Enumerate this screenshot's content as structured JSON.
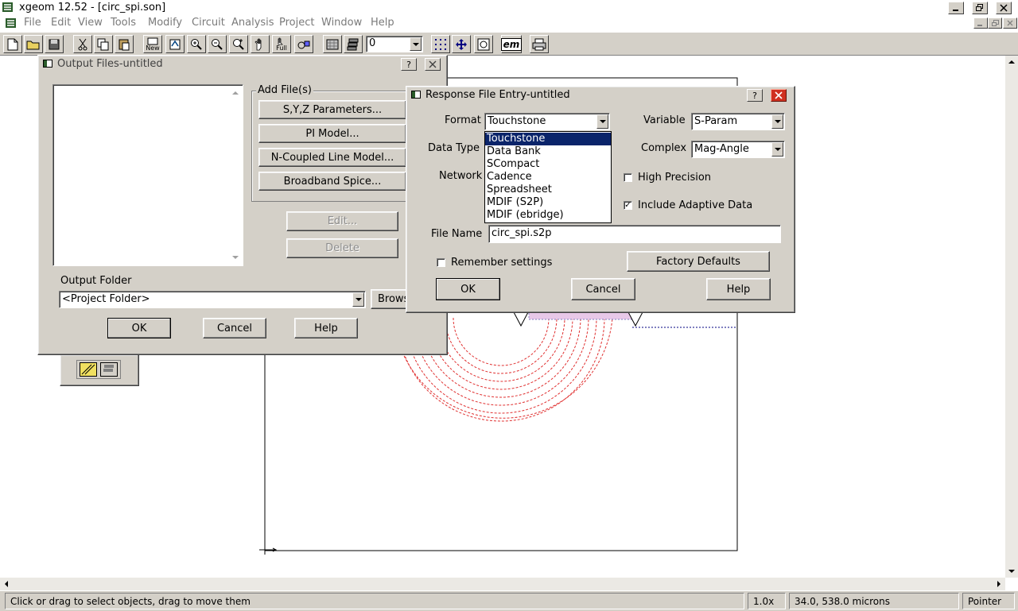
{
  "app": {
    "title": "xgeom 12.52 - [circ_spi.son]",
    "window_controls": [
      "minimize-icon",
      "restore-icon",
      "close-icon"
    ]
  },
  "menu": [
    "File",
    "Edit",
    "View",
    "Tools",
    "Modify",
    "Circuit",
    "Analysis",
    "Project",
    "Window",
    "Help"
  ],
  "toolbar": {
    "icons": [
      "new-file-icon",
      "open-folder-icon",
      "save-icon",
      "cut-icon",
      "copy-icon",
      "paste-icon",
      "new-view-icon",
      "rotate-icon",
      "zoom-in-icon",
      "zoom-out-icon",
      "zoom-box-icon",
      "pan-hand-icon",
      "full-view-icon",
      "cells-icon",
      "grid-icon",
      "layers-icon"
    ],
    "new_label": "New",
    "full_label": "Full",
    "level_value": "0",
    "em_label": "em"
  },
  "output_dialog": {
    "title": "Output Files-untitled",
    "add_files_group": "Add File(s)",
    "syz_button": "S,Y,Z Parameters...",
    "pi_button": "PI Model...",
    "ncoupled_button": "N-Coupled Line Model...",
    "spice_button": "Broadband Spice...",
    "edit_button": "Edit...",
    "delete_button": "Delete",
    "output_folder_label": "Output Folder",
    "output_folder_value": "<Project Folder>",
    "browse_button": "Brows",
    "ok_button": "OK",
    "cancel_button": "Cancel",
    "help_button": "Help"
  },
  "response_dialog": {
    "title": "Response File Entry-untitled",
    "format_label": "Format",
    "format_value": "Touchstone",
    "format_options": [
      "Touchstone",
      "Data Bank",
      "SCompact",
      "Cadence",
      "Spreadsheet",
      "MDIF (S2P)",
      "MDIF (ebridge)"
    ],
    "data_type_label": "Data Type",
    "network_label": "Network",
    "variable_label": "Variable",
    "variable_value": "S-Param",
    "complex_label": "Complex",
    "complex_value": "Mag-Angle",
    "high_precision_label": "High Precision",
    "high_precision_checked": false,
    "adaptive_label": "Include Adaptive Data",
    "adaptive_checked": true,
    "file_name_label": "File Name",
    "file_name_value": "circ_spi.s2p",
    "remember_label": "Remember settings",
    "remember_checked": false,
    "factory_button": "Factory Defaults",
    "ok_button": "OK",
    "cancel_button": "Cancel",
    "help_button": "Help"
  },
  "statusbar": {
    "message": "Click or drag to select objects, drag to move them",
    "zoom": "1.0x",
    "coords": "34.0, 538.0 microns",
    "mode": "Pointer"
  },
  "colors": {
    "face": "#d4d0c8",
    "selection": "#0a246a",
    "spiral": "#e03030",
    "metal": "#c8a0c8"
  }
}
